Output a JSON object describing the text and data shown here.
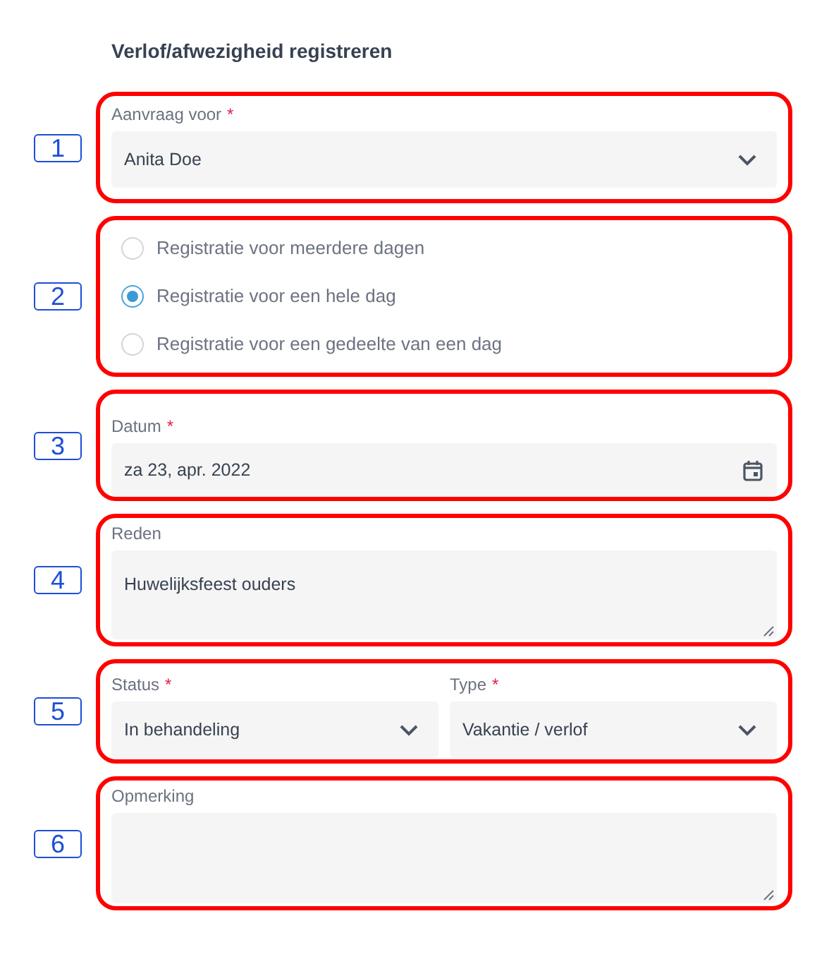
{
  "title": "Verlof/afwezigheid registreren",
  "sections": [
    {
      "marker": "1",
      "kind": "select",
      "label": "Aanvraag voor",
      "mark": "*",
      "value": "Anita Doe"
    },
    {
      "marker": "2",
      "kind": "radios",
      "options": [
        {
          "label": "Registratie voor meerdere dagen",
          "selected": false
        },
        {
          "label": "Registratie voor een hele dag",
          "selected": true
        },
        {
          "label": "Registratie voor een gedeelte van een dag",
          "selected": false
        }
      ]
    },
    {
      "marker": "3",
      "kind": "date",
      "label": "Datum",
      "mark": "*",
      "value": "za 23, apr. 2022"
    },
    {
      "marker": "4",
      "kind": "textarea",
      "label": "Reden",
      "value": "Huwelijksfeest ouders"
    },
    {
      "marker": "5",
      "kind": "pair",
      "fields": [
        {
          "label": "Status",
          "mark": "*",
          "value": "In behandeling"
        },
        {
          "label": "Type",
          "mark": "*",
          "value": "Vakantie / verlof"
        }
      ]
    },
    {
      "marker": "6",
      "kind": "textarea",
      "label": "Opmerking"
    }
  ]
}
